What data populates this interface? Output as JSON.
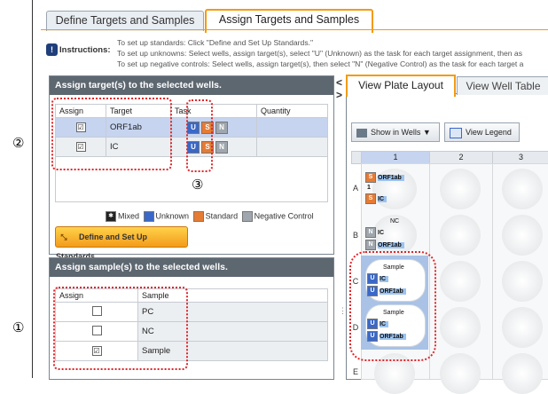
{
  "window": {
    "tabs": [
      {
        "label": "Define Targets and Samples",
        "active": false
      },
      {
        "label": "Assign Targets and Samples",
        "active": true
      }
    ],
    "accent_color": "#f29b12"
  },
  "instructions": {
    "label": "Instructions:",
    "lines": [
      "To set up standards: Click \"Define and Set Up Standards.\"",
      "To set up unknowns: Select wells, assign target(s), select \"U\" (Unknown) as the task for each target assignment, then as",
      "To set up negative controls: Select wells, assign target(s), then select \"N\" (Negative Control) as the task for each target a"
    ]
  },
  "callouts": {
    "one": "①",
    "two": "②",
    "three": "③"
  },
  "targets_panel": {
    "title": "Assign target(s) to the selected wells.",
    "headers": {
      "assign": "Assign",
      "target": "Target",
      "task": "Task",
      "quantity": "Quantity"
    },
    "rows": [
      {
        "checked": "☑",
        "target": "ORF1ab",
        "task_u": "U",
        "task_s": "S",
        "task_n": "N",
        "quantity": ""
      },
      {
        "checked": "☑",
        "target": "IC",
        "task_u": "U",
        "task_s": "S",
        "task_n": "N",
        "quantity": ""
      }
    ],
    "legend": {
      "mixed": "Mixed",
      "unknown": "Unknown",
      "standard": "Standard",
      "negative": "Negative Control"
    },
    "define_button": "Define and Set Up Standards"
  },
  "samples_panel": {
    "title": "Assign sample(s) to the selected wells.",
    "headers": {
      "assign": "Assign",
      "sample": "Sample"
    },
    "rows": [
      {
        "checked": "",
        "sample": "PC"
      },
      {
        "checked": "",
        "sample": "NC"
      },
      {
        "checked": "☑",
        "sample": "Sample"
      }
    ]
  },
  "right_panel": {
    "collapse_glyph": "<",
    "expand_glyph": ">",
    "tabs": [
      {
        "label": "View Plate Layout",
        "active": true
      },
      {
        "label": "View Well Table",
        "active": false
      }
    ],
    "toolbar": {
      "show_in_wells": "Show in Wells ▼",
      "view_legend": "View Legend"
    },
    "columns": [
      "1",
      "2",
      "3"
    ],
    "rows": [
      "A",
      "B",
      "C",
      "D",
      "E"
    ],
    "wells": {
      "A1": {
        "s_task": "S",
        "target1": "ORF1ab",
        "line2": "1",
        "target2": "IC"
      },
      "B1": {
        "sample": "NC",
        "target1": "IC",
        "target2": "ORF1ab"
      },
      "C1": {
        "sample": "Sample",
        "target1": "IC",
        "target2": "ORF1ab"
      },
      "D1": {
        "sample": "Sample",
        "target1": "IC",
        "target2": "ORF1ab"
      }
    },
    "task_colors": {
      "U": "#3a68c8",
      "S": "#e67b33",
      "N": "#9fa6ad"
    }
  }
}
